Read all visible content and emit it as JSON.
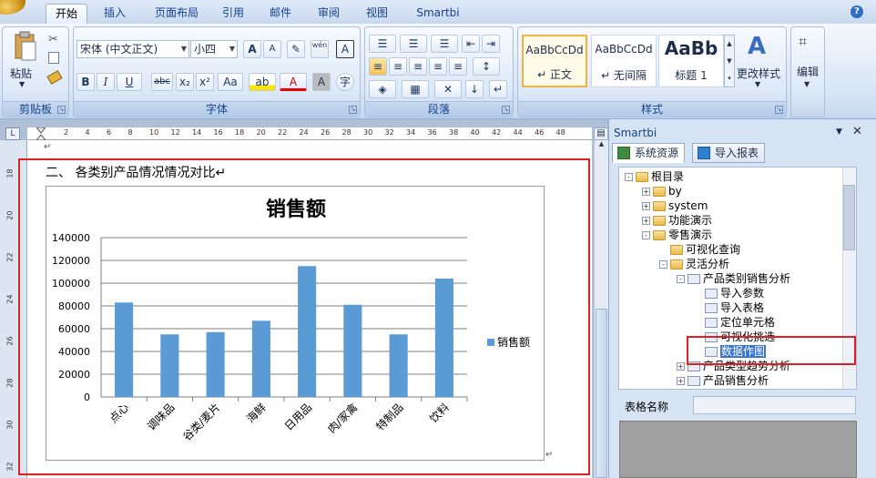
{
  "ribbon_tabs": [
    "开始",
    "插入",
    "页面布局",
    "引用",
    "邮件",
    "审阅",
    "视图",
    "Smartbi"
  ],
  "help_label": "?",
  "clipboard": {
    "paste_label": "粘贴",
    "group_label": "剪贴板"
  },
  "font": {
    "font_name": "宋体 (中文正文)",
    "font_size": "小四",
    "group_label": "字体",
    "bold": "B",
    "italic": "I",
    "underline": "U",
    "strike": "abc",
    "sub": "x₂",
    "sup": "x²",
    "case": "Aa",
    "grow": "A",
    "shrink": "A",
    "clear": "✎",
    "phonetic": "wén",
    "enclosed": "A",
    "shade": "A",
    "circle": "字"
  },
  "paragraph": {
    "group_label": "段落"
  },
  "styles": {
    "group_label": "样式",
    "items": [
      {
        "preview": "AaBbCcDd",
        "name": "↵ 正文"
      },
      {
        "preview": "AaBbCcDd",
        "name": "↵ 无间隔"
      },
      {
        "preview": "AaBb",
        "name": "标题 1"
      }
    ],
    "change_label": "更改样式"
  },
  "editing": {
    "label": "编辑"
  },
  "ruler": {
    "ticks": [
      "2",
      "4",
      "6",
      "8",
      "10",
      "12",
      "14",
      "16",
      "18",
      "20",
      "22",
      "24",
      "26",
      "28",
      "30",
      "32",
      "34",
      "36",
      "38",
      "40",
      "42",
      "44",
      "46",
      "48"
    ],
    "vticks": [
      "18",
      "20",
      "22",
      "24",
      "26",
      "28",
      "30",
      "32"
    ],
    "corner": "L"
  },
  "document": {
    "heading": "二、    各类别产品情况情况对比↵",
    "top_mark": "↵",
    "end_mark": "↵"
  },
  "chart_data": {
    "type": "bar",
    "title": "销售额",
    "categories": [
      "点心",
      "调味品",
      "谷类/麦片",
      "海鲜",
      "日用品",
      "肉/家禽",
      "特制品",
      "饮料"
    ],
    "series": [
      {
        "name": "销售额",
        "values": [
          83000,
          55000,
          57000,
          67000,
          115000,
          81000,
          55000,
          104000
        ]
      }
    ],
    "ylim": [
      0,
      140000
    ],
    "yticks": [
      "0",
      "20000",
      "40000",
      "60000",
      "80000",
      "100000",
      "120000",
      "140000"
    ],
    "legend": "right",
    "grid": true,
    "color": "#5b9bd5"
  },
  "panel": {
    "title": "Smartbi",
    "tabs": [
      "系统资源",
      "导入报表"
    ],
    "tree": [
      {
        "label": "根目录",
        "level": 0,
        "icon": "folder",
        "toggle": "-"
      },
      {
        "label": "by",
        "level": 1,
        "icon": "folder",
        "toggle": "+"
      },
      {
        "label": "system",
        "level": 1,
        "icon": "folder",
        "toggle": "+"
      },
      {
        "label": "功能演示",
        "level": 1,
        "icon": "folder",
        "toggle": "+"
      },
      {
        "label": "零售演示",
        "level": 1,
        "icon": "folder",
        "toggle": "-"
      },
      {
        "label": "可视化查询",
        "level": 2,
        "icon": "folder",
        "toggle": ""
      },
      {
        "label": "灵活分析",
        "level": 2,
        "icon": "folder",
        "toggle": "-"
      },
      {
        "label": "产品类别销售分析",
        "level": 3,
        "icon": "report",
        "toggle": "-"
      },
      {
        "label": "导入参数",
        "level": 4,
        "icon": "report",
        "toggle": ""
      },
      {
        "label": "导入表格",
        "level": 4,
        "icon": "report",
        "toggle": ""
      },
      {
        "label": "定位单元格",
        "level": 4,
        "icon": "report",
        "toggle": ""
      },
      {
        "label": "可视化挑选",
        "level": 4,
        "icon": "report",
        "toggle": ""
      },
      {
        "label": "数据作图",
        "level": 4,
        "icon": "report",
        "toggle": "",
        "selected": true
      },
      {
        "label": "产品类型趋势分析",
        "level": 3,
        "icon": "report",
        "toggle": "+"
      },
      {
        "label": "产品销售分析",
        "level": 3,
        "icon": "report",
        "toggle": "+"
      }
    ],
    "table_name_label": "表格名称",
    "table_name_value": ""
  }
}
